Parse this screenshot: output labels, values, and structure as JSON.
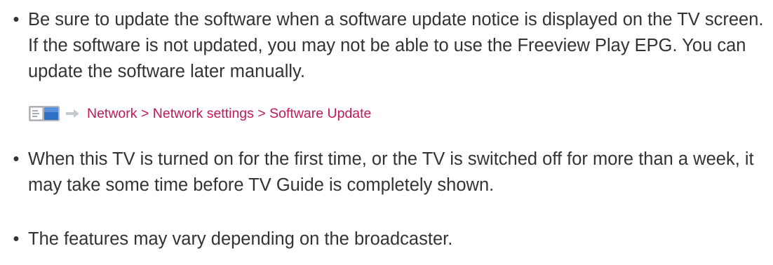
{
  "bullets": [
    {
      "symbol": "•",
      "text": "Be sure to update the software when a software update notice is displayed on the TV screen. If the software is not updated, you may not be able to use the Freeview Play EPG. You can update the software later manually."
    },
    {
      "symbol": "•",
      "text": "When this TV is turned on for the first time, or the TV is switched off for more than a week, it may take some time before TV Guide is completely shown."
    },
    {
      "symbol": "•",
      "text": "The features may vary depending on the broadcaster."
    }
  ],
  "menu_path": {
    "icons": [
      "menu-icon",
      "right-arrow-icon"
    ],
    "items": [
      "Network",
      "Network settings",
      "Software Update"
    ],
    "separator": ">",
    "color": "#c0185a"
  }
}
